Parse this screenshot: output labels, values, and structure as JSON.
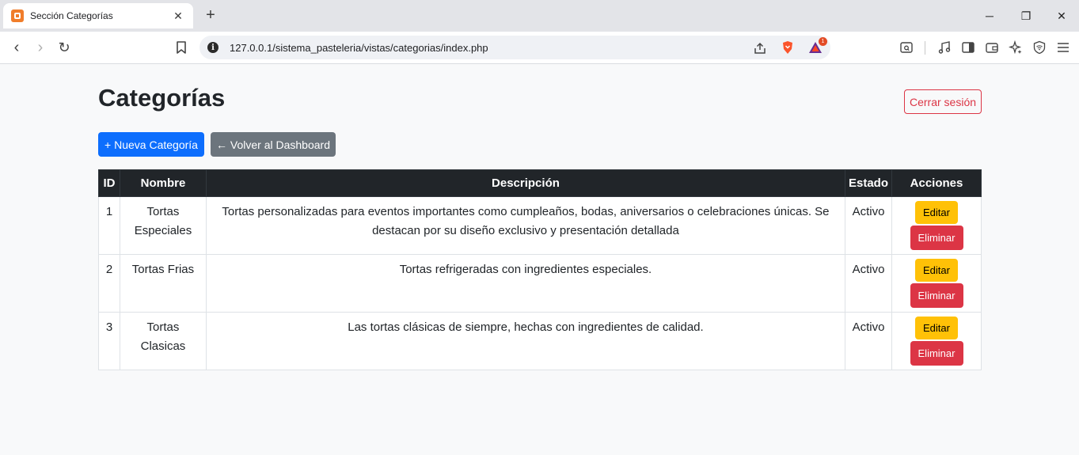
{
  "browser": {
    "tab_title": "Sección Categorías",
    "tab_close": "✕",
    "new_tab": "+",
    "url": "127.0.0.1/sistema_pasteleria/vistas/categorias/index.php",
    "notification_count": "1",
    "window_controls": {
      "minimize": "─",
      "restore": "❐",
      "close": "✕"
    },
    "nav": {
      "back": "‹",
      "forward": "›",
      "reload": "↻"
    }
  },
  "page": {
    "title": "Categorías",
    "logout_label": "Cerrar sesión",
    "new_category_label": "+ Nueva Categoría",
    "back_dashboard_label": "← Volver al Dashboard"
  },
  "table": {
    "headers": [
      "ID",
      "Nombre",
      "Descripción",
      "Estado",
      "Acciones"
    ],
    "rows": [
      {
        "id": "1",
        "nombre": "Tortas Especiales",
        "descripcion": "Tortas personalizadas para eventos importantes como cumpleaños, bodas, aniversarios o celebraciones únicas. Se destacan por su diseño exclusivo y presentación detallada",
        "estado": "Activo",
        "edit_label": "Editar",
        "delete_label": "Eliminar"
      },
      {
        "id": "2",
        "nombre": "Tortas Frias",
        "descripcion": "Tortas refrigeradas con ingredientes especiales.",
        "estado": "Activo",
        "edit_label": "Editar",
        "delete_label": "Eliminar"
      },
      {
        "id": "3",
        "nombre": "Tortas Clasicas",
        "descripcion": "Las tortas clásicas de siempre, hechas con ingredientes de calidad.",
        "estado": "Activo",
        "edit_label": "Editar",
        "delete_label": "Eliminar"
      }
    ]
  },
  "colors": {
    "primary": "#0d6efd",
    "secondary": "#6c757d",
    "warning": "#ffc107",
    "danger": "#dc3545",
    "table_header": "#212529",
    "page_bg": "#f8f9fa"
  }
}
